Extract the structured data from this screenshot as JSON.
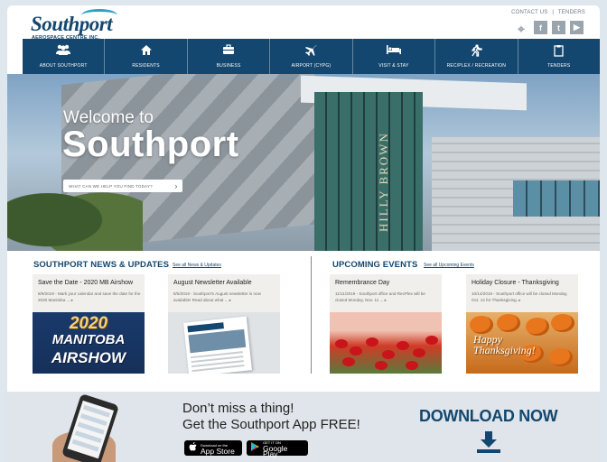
{
  "header": {
    "logo_name": "Southport",
    "logo_sub": "AEROSPACE CENTRE INC.",
    "contact_link": "CONTACT US",
    "separator": "|",
    "tenders_link": "TENDERS",
    "social": [
      "map-pin-icon",
      "facebook-icon",
      "twitter-icon",
      "youtube-icon"
    ]
  },
  "nav": {
    "items": [
      {
        "label": "ABOUT SOUTHPORT",
        "icon": "group-icon",
        "glyph": "👥"
      },
      {
        "label": "RESIDENTS",
        "icon": "home-icon",
        "glyph": "⌂"
      },
      {
        "label": "BUSINESS",
        "icon": "briefcase-icon",
        "glyph": "💼"
      },
      {
        "label": "AIRPORT (CYPG)",
        "icon": "airplane-icon",
        "glyph": "✈"
      },
      {
        "label": "VISIT & STAY",
        "icon": "bed-icon",
        "glyph": "🛏"
      },
      {
        "label": "REC/PLEX / RECREATION",
        "icon": "running-icon",
        "glyph": "✗"
      },
      {
        "label": "TENDERS",
        "icon": "clipboard-icon",
        "glyph": "📋"
      }
    ]
  },
  "hero": {
    "welcome": "Welcome to",
    "title": "Southport",
    "search_placeholder": "WHAT CAN WE HELP YOU FIND TODAY?",
    "sign_text": "HILLY BROWN"
  },
  "news": {
    "heading": "SOUTHPORT NEWS & UPDATES",
    "see_all": "See all News & Updates",
    "cards": [
      {
        "title": "Save the Date - 2020 MB Airshow",
        "desc": "8/9/2019 - Mark your calendar and save the date for the 2020 Manitoba ... ▸",
        "img_year": "2020",
        "img_manitoba": "MANITOBA",
        "img_airshow": "AIRSHOW"
      },
      {
        "title": "August Newsletter Available",
        "desc": "8/5/2019 - Southport's August newsletter is now available! Read about what ... ▸"
      }
    ]
  },
  "events": {
    "heading": "UPCOMING EVENTS",
    "see_all": "See all Upcoming Events",
    "cards": [
      {
        "title": "Remembrance Day",
        "desc": "11/11/2019 - Southport office and RecPlex will be closed Monday, Nov. 11 ... ▸"
      },
      {
        "title": "Holiday Closure - Thanksgiving",
        "desc": "10/14/2019 - Southport office will be closed Monday, Oct. 14 for Thanksgiving. ▸",
        "img_text1": "Happy",
        "img_text2": "Thanksgiving!"
      }
    ]
  },
  "app": {
    "line1": "Don’t miss a thing!",
    "line2": "Get the Southport App FREE!",
    "appstore_small": "Download on the",
    "appstore_big": "App Store",
    "googleplay_small": "GET IT ON",
    "googleplay_big": "Google Play",
    "download": "DOWNLOAD NOW"
  }
}
